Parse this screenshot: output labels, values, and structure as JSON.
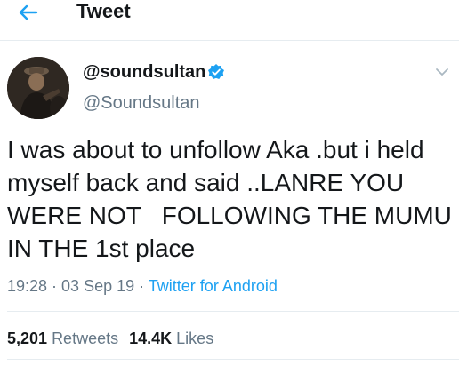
{
  "colors": {
    "accent": "#1da1f2",
    "text": "#14171a",
    "muted": "#657786",
    "border": "#e6ecf0"
  },
  "header": {
    "back_icon": "arrow-left-icon",
    "title": "Tweet"
  },
  "author": {
    "display_name": "@soundsultan",
    "verified_icon": "verified-badge-icon",
    "handle": "@Soundsultan",
    "menu_icon": "chevron-down-icon"
  },
  "tweet": {
    "text": "I was about to unfollow Aka .but i held myself back and said ..LANRE YOU WERE NOT   FOLLOWING THE MUMU IN THE 1st place",
    "time": "19:28",
    "date": "03 Sep 19",
    "separator": " · ",
    "source": "Twitter for Android"
  },
  "stats": {
    "retweets_count": "5,201",
    "retweets_label": "Retweets",
    "likes_count": "14.4K",
    "likes_label": "Likes"
  }
}
